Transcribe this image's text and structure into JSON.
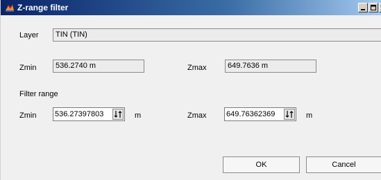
{
  "window": {
    "title": "Z-range filter"
  },
  "layer": {
    "label": "Layer",
    "value": "TIN (TIN)"
  },
  "current": {
    "zmin_label": "Zmin",
    "zmin_value": "536.2740 m",
    "zmax_label": "Zmax",
    "zmax_value": "649.7636 m"
  },
  "filter_range": {
    "heading": "Filter range",
    "zmin_label": "Zmin",
    "zmin_value": "536.27397803",
    "zmin_unit": "m",
    "zmax_label": "Zmax",
    "zmax_value": "649.76362369",
    "zmax_unit": "m"
  },
  "buttons": {
    "ok": "OK",
    "cancel": "Cancel"
  },
  "colors": {
    "titlebar_start": "#0a246a",
    "titlebar_end": "#a6caf0"
  },
  "icons": {
    "app": "z-range-filter-icon",
    "minimize": "minimize-icon",
    "maximize": "maximize-icon",
    "close": "close-icon",
    "spin": "spin-arrows-icon"
  }
}
